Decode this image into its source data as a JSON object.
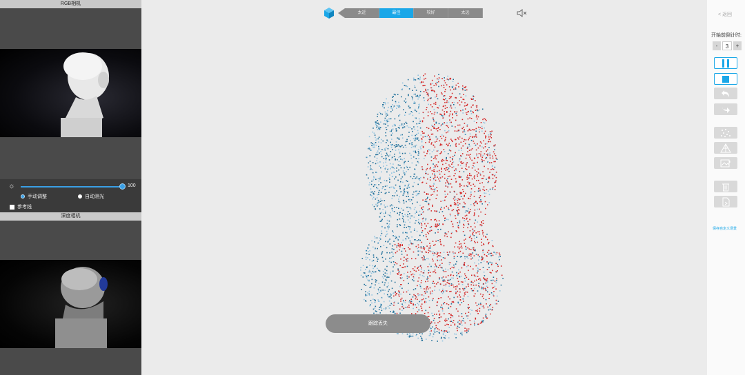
{
  "left": {
    "rgb_title": "RGB相机",
    "depth_title": "深度相机",
    "brightness_value": "100",
    "brightness_level": 1.0,
    "manual_label": "手动调整",
    "auto_label": "自动测光",
    "reference_label": "参考线"
  },
  "toolbar": {
    "segments": [
      "太近",
      "最佳",
      "较好",
      "太远"
    ],
    "active_segment": 1,
    "accent": "#1aa7e8",
    "icons": [
      "cube-icon",
      "mute-icon"
    ]
  },
  "status": {
    "text": "跟踪丢失"
  },
  "right": {
    "back_label": "< 返回",
    "countdown_label": "开始前倒计时:",
    "minus": "-",
    "count": "3",
    "plus": "+",
    "save_label": "保存自定义场景",
    "icons": [
      "pause-icon",
      "stop-icon",
      "undo-icon",
      "redo-icon",
      "point-cloud-icon",
      "mesh-icon",
      "image-add-icon",
      "trash-icon",
      "export-icon"
    ]
  },
  "colors": {
    "cloud_blue": "#1f6f9a",
    "cloud_light": "#8fc3e0",
    "cloud_red": "#d42a2a"
  }
}
